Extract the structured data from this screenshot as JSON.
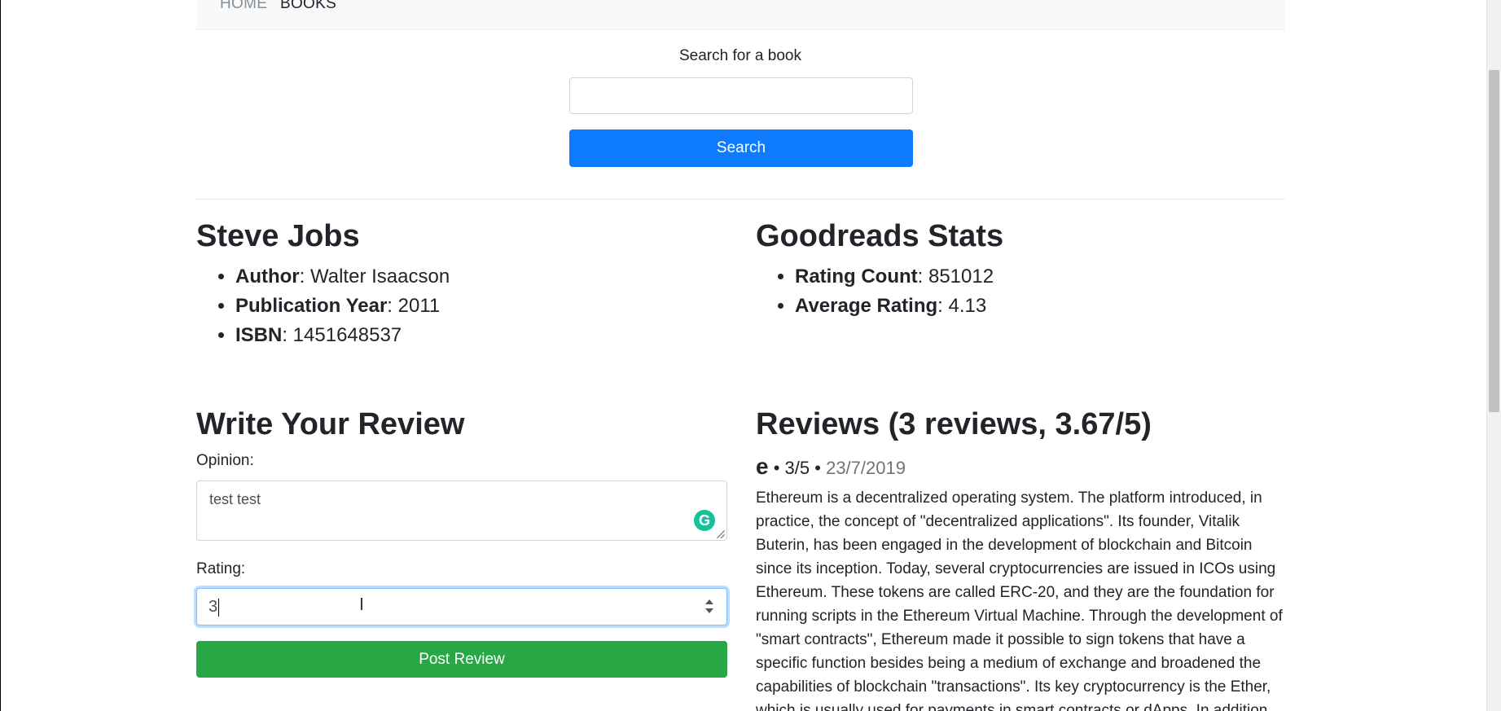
{
  "nav": {
    "home": "HOME",
    "books": "BOOKS"
  },
  "search": {
    "label": "Search for a book",
    "value": "",
    "button": "Search"
  },
  "book": {
    "title": "Steve Jobs",
    "author_label": "Author",
    "author": ": Walter Isaacson",
    "year_label": "Publication Year",
    "year": ": 2011",
    "isbn_label": "ISBN",
    "isbn": ": 1451648537"
  },
  "stats": {
    "title": "Goodreads Stats",
    "count_label": "Rating Count",
    "count": ": 851012",
    "avg_label": "Average Rating",
    "avg": ": 4.13"
  },
  "review_form": {
    "title": "Write Your Review",
    "opinion_label": "Opinion:",
    "opinion_value": "test test",
    "rating_label": "Rating:",
    "rating_value": "3",
    "submit": "Post Review"
  },
  "reviews": {
    "title": "Reviews (3 reviews, 3.67/5)",
    "items": [
      {
        "user": "e",
        "rating": "3/5",
        "date": "23/7/2019",
        "text": "Ethereum is a decentralized operating system. The platform introduced, in practice, the concept of \"decentralized applications\". Its founder, Vitalik Buterin, has been engaged in the development of blockchain and Bitcoin since its inception. Today, several cryptocurrencies are issued in ICOs using Ethereum. These tokens are called ERC-20, and they are the foundation for running scripts in the Ethereum Virtual Machine. Through the development of \"smart contracts\", Ethereum made it possible to sign tokens that have a specific function besides being a medium of exchange and broadened the capabilities of blockchain \"transactions\". Its key cryptocurrency is the Ether, which is usually used for payments in smart contracts or dApps. In addition"
      }
    ]
  },
  "colors": {
    "primary": "#0d7bfc",
    "success": "#28a745",
    "navbar_bg": "#f8f9fa",
    "muted": "#6c757d"
  },
  "icons": {
    "grammarly": "grammarly-icon",
    "text_cursor": "text-cursor-icon"
  }
}
